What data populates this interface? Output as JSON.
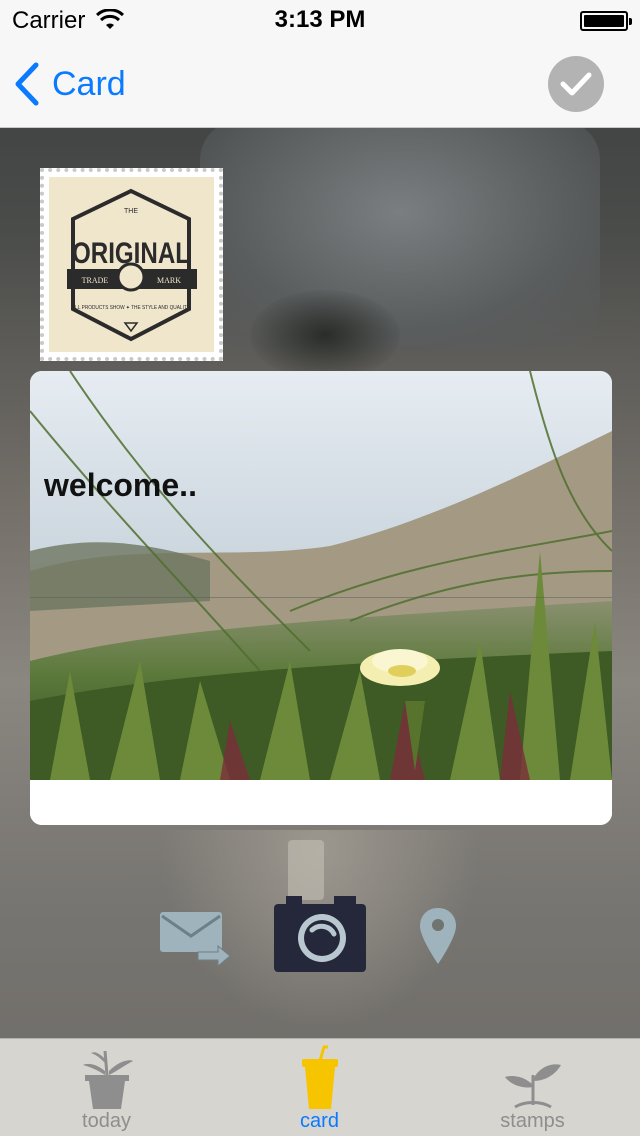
{
  "status_bar": {
    "carrier": "Carrier",
    "time": "3:13 PM",
    "wifi_icon": "wifi-icon",
    "battery_icon": "battery-full-icon"
  },
  "nav_bar": {
    "back_label": "Card",
    "back_icon": "chevron-left-icon",
    "confirm_icon": "checkmark-circle-icon",
    "accent_color": "#0a7aff"
  },
  "stamp": {
    "logo_top": "THE",
    "logo_main": "ORIGINAL",
    "logo_left": "TRADE",
    "logo_right": "MARK",
    "logo_bottom": "ALL PRODUCTS SHOW ✦ THE STYLE AND QUALITY"
  },
  "card": {
    "message": "welcome.."
  },
  "actions": [
    {
      "name": "mail-forward-icon"
    },
    {
      "name": "camera-icon"
    },
    {
      "name": "location-pin-icon"
    }
  ],
  "tab_bar": {
    "active_color": "#0a7aff",
    "inactive_color": "#8e8e8e",
    "tabs": [
      {
        "label": "today",
        "icon": "potted-plant-icon",
        "active": false
      },
      {
        "label": "card",
        "icon": "cup-icon",
        "active": true
      },
      {
        "label": "stamps",
        "icon": "sprout-icon",
        "active": false
      }
    ]
  }
}
